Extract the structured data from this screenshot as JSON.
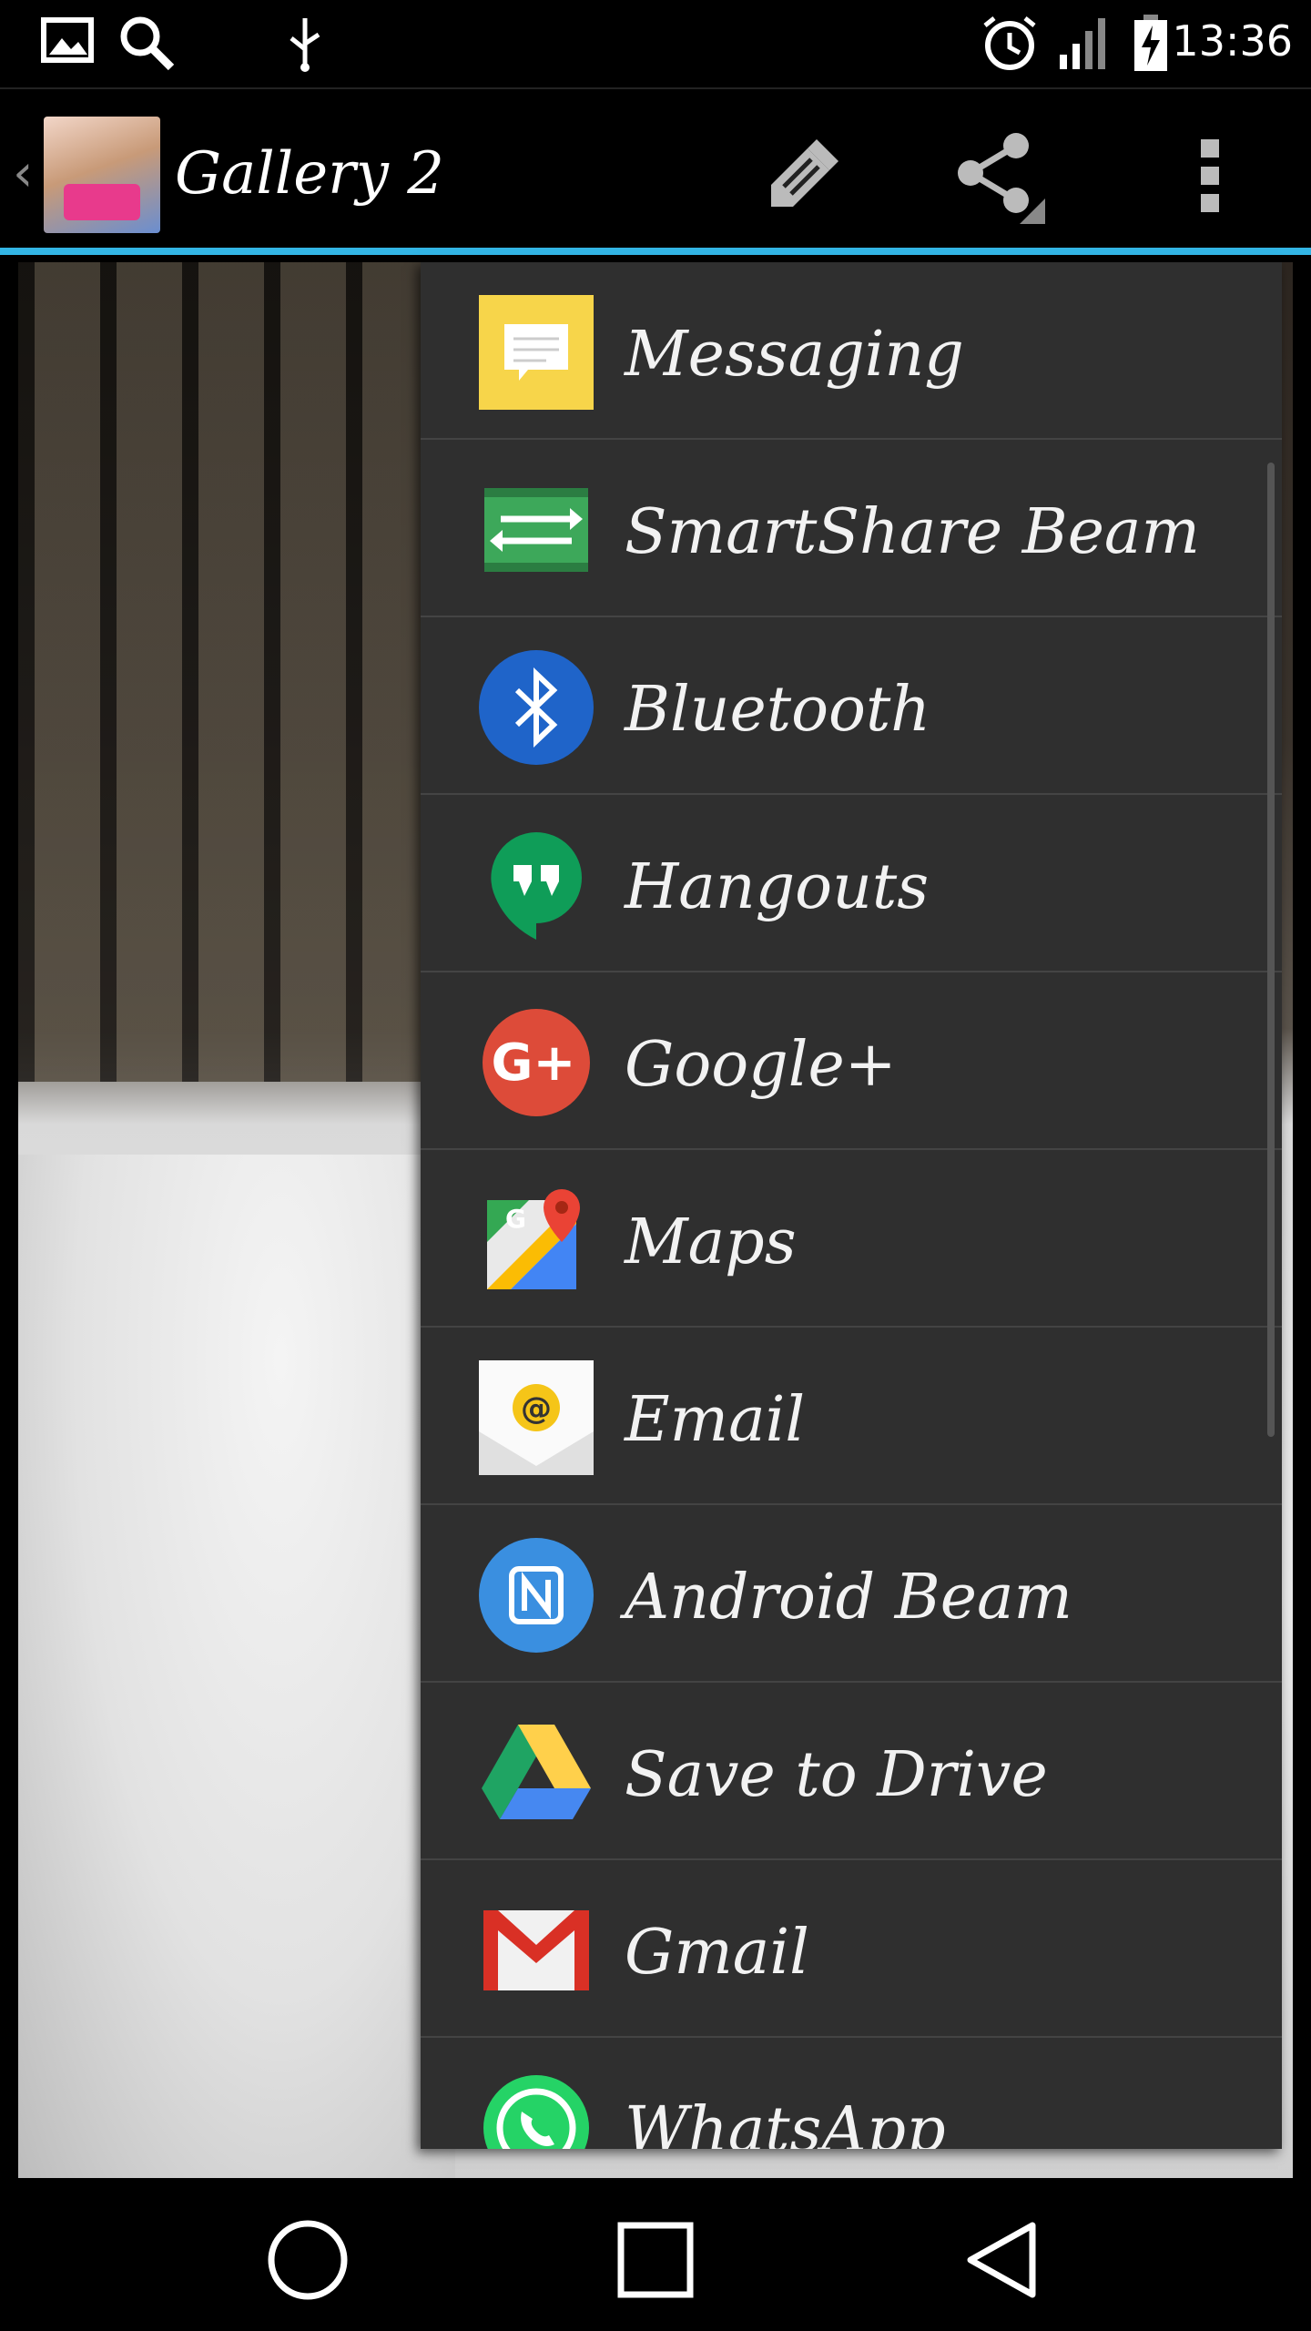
{
  "status_bar": {
    "time": "13:36",
    "icons": [
      "gallery-notification-icon",
      "search-notification-icon",
      "usb-icon",
      "alarm-icon",
      "signal-icon",
      "battery-charging-icon"
    ]
  },
  "action_bar": {
    "up_caret": "‹",
    "title": "Gallery 2",
    "thumbnail_icon": "app-thumbnail",
    "actions": [
      "edit-icon",
      "share-icon",
      "overflow-menu-icon"
    ]
  },
  "share_menu": {
    "items": [
      {
        "label": "Messaging",
        "icon": "messaging-icon",
        "color": "#f7d54a"
      },
      {
        "label": "SmartShare Beam",
        "icon": "smartshare-beam-icon",
        "color": "#3da85a"
      },
      {
        "label": "Bluetooth",
        "icon": "bluetooth-icon",
        "color": "#1f64c9"
      },
      {
        "label": "Hangouts",
        "icon": "hangouts-icon",
        "color": "#0f9d58"
      },
      {
        "label": "Google+",
        "icon": "google-plus-icon",
        "color": "#dd4b39"
      },
      {
        "label": "Maps",
        "icon": "maps-icon",
        "color": "#4285f4"
      },
      {
        "label": "Email",
        "icon": "email-icon",
        "color": "#f5c518"
      },
      {
        "label": "Android Beam",
        "icon": "android-beam-icon",
        "color": "#3a8fe0"
      },
      {
        "label": "Save to Drive",
        "icon": "drive-icon",
        "color": "#1fa463"
      },
      {
        "label": "Gmail",
        "icon": "gmail-icon",
        "color": "#d93025"
      },
      {
        "label": "WhatsApp",
        "icon": "whatsapp-icon",
        "color": "#25d366"
      }
    ]
  },
  "nav_bar": {
    "buttons": [
      "home-button",
      "recents-button",
      "back-button"
    ]
  },
  "colors": {
    "accent": "#33b5e5",
    "menu_bg": "#2f2f2f",
    "divider": "#444444"
  }
}
